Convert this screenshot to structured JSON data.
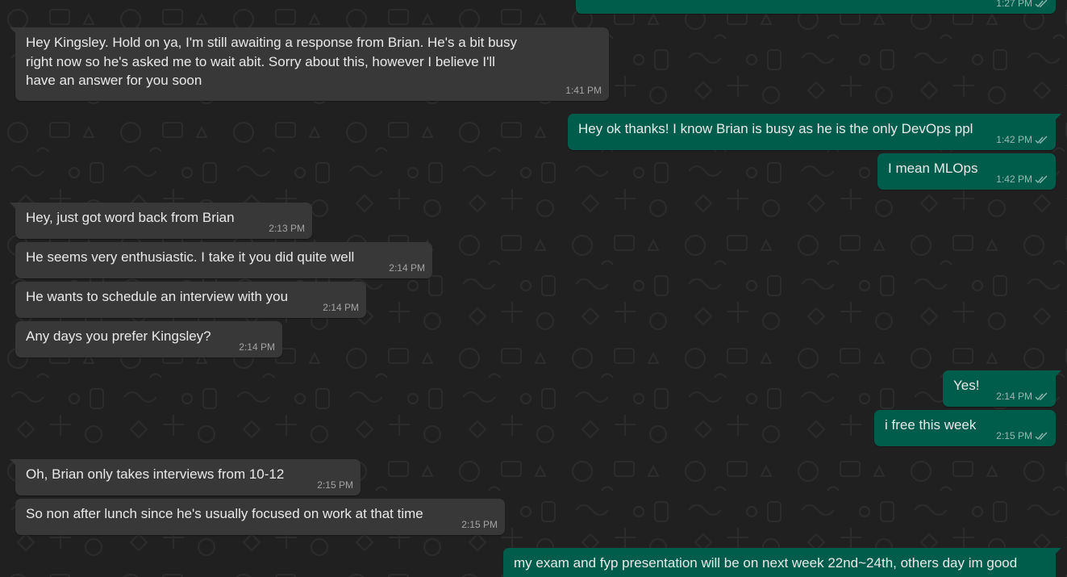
{
  "colors": {
    "background": "#202020",
    "incoming_bubble": "#383838",
    "outgoing_bubble": "#005c4b",
    "text": "#e9e9e9"
  },
  "icons": {
    "read_receipt": "double-check-icon"
  },
  "messages": [
    {
      "text": "",
      "time": "1:27 PM"
    },
    {
      "text": "Hey Kingsley. Hold on ya, I'm still awaiting a response from Brian. He's a bit busy right now so he's asked me to wait abit. Sorry about this, however I believe I'll have an answer for you soon",
      "time": "1:41 PM"
    },
    {
      "text": "Hey ok thanks! I know Brian is busy as he is the only DevOps ppl",
      "time": "1:42 PM"
    },
    {
      "text": "I mean MLOps",
      "time": "1:42 PM"
    },
    {
      "text": "Hey, just got word back from Brian",
      "time": "2:13 PM"
    },
    {
      "text": "He seems very enthusiastic. I take it you did quite well",
      "time": "2:14 PM"
    },
    {
      "text": "He wants to schedule an interview with you",
      "time": "2:14 PM"
    },
    {
      "text": "Any days you prefer Kingsley?",
      "time": "2:14 PM"
    },
    {
      "text": "Yes!",
      "time": "2:14 PM"
    },
    {
      "text": "i free this week",
      "time": "2:15 PM"
    },
    {
      "text": "Oh, Brian only takes interviews from 10-12",
      "time": "2:15 PM"
    },
    {
      "text": "So non after lunch since he's usually focused on work at that time",
      "time": "2:15 PM"
    },
    {
      "text": "my exam and fyp presentation will be on next week 22nd~24th, others day im good",
      "time": ""
    }
  ]
}
